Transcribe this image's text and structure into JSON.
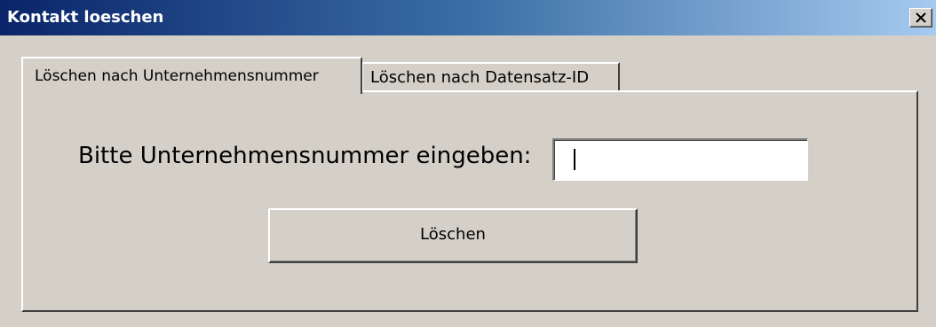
{
  "window": {
    "title": "Kontakt loeschen",
    "close_icon": "close-icon"
  },
  "tabs": [
    {
      "label": "Löschen nach Unternehmensnummer",
      "active": true
    },
    {
      "label": "Löschen nach Datensatz-ID",
      "active": false
    }
  ],
  "form": {
    "prompt_label": "Bitte Unternehmensnummer eingeben:",
    "company_number_value": "",
    "delete_button_label": "Löschen"
  },
  "colors": {
    "title_gradient_start": "#0a246a",
    "title_gradient_end": "#a6caf0",
    "face": "#d4d0c8"
  }
}
